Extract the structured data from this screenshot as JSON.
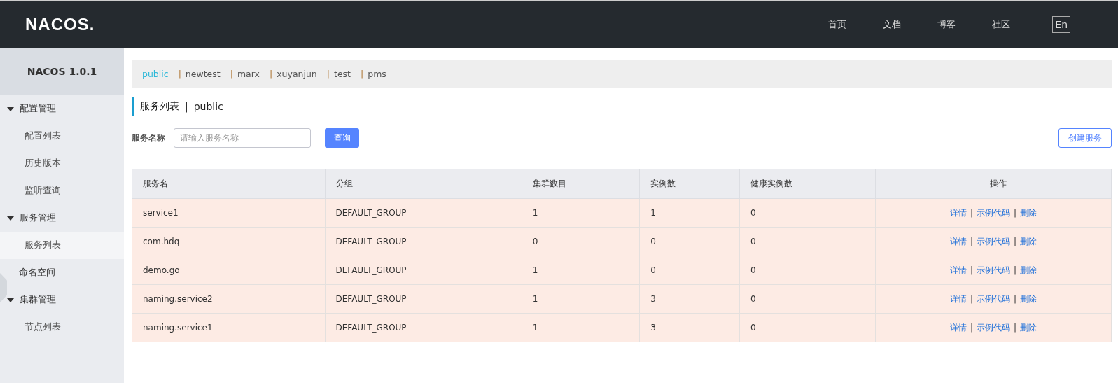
{
  "header": {
    "logo": "NACOS.",
    "nav": [
      "首页",
      "文档",
      "博客",
      "社区"
    ],
    "language_button": "En"
  },
  "sidebar": {
    "title": "NACOS 1.0.1",
    "items": [
      {
        "kind": "group",
        "label": "配置管理",
        "expanded": true,
        "children": [
          {
            "label": "配置列表",
            "selected": false
          },
          {
            "label": "历史版本",
            "selected": false
          },
          {
            "label": "监听查询",
            "selected": false
          }
        ]
      },
      {
        "kind": "group",
        "label": "服务管理",
        "expanded": true,
        "children": [
          {
            "label": "服务列表",
            "selected": true
          }
        ]
      },
      {
        "kind": "link",
        "label": "命名空间",
        "selected": false
      },
      {
        "kind": "group",
        "label": "集群管理",
        "expanded": true,
        "children": [
          {
            "label": "节点列表",
            "selected": false
          }
        ]
      }
    ]
  },
  "namespaces": [
    {
      "kind": "tab",
      "text": "public",
      "selected": true
    },
    {
      "kind": "sep",
      "text": "|"
    },
    {
      "kind": "tab",
      "text": "newtest",
      "selected": false
    },
    {
      "kind": "sep",
      "text": "|"
    },
    {
      "kind": "tab",
      "text": "marx",
      "selected": false
    },
    {
      "kind": "sep",
      "text": "|"
    },
    {
      "kind": "tab",
      "text": "xuyanjun",
      "selected": false
    },
    {
      "kind": "sep",
      "text": "|"
    },
    {
      "kind": "tab",
      "text": "test",
      "selected": false
    },
    {
      "kind": "sep",
      "text": "|"
    },
    {
      "kind": "tab",
      "text": "pms",
      "selected": false
    }
  ],
  "page_title": {
    "title": "服务列表",
    "separator": "|",
    "namespace": "public"
  },
  "search": {
    "label": "服务名称",
    "placeholder": "请输入服务名称",
    "button": "查询",
    "create_button": "创建服务"
  },
  "table": {
    "columns": [
      "服务名",
      "分组",
      "集群数目",
      "实例数",
      "健康实例数",
      "操作"
    ],
    "rows": [
      {
        "cells": [
          "service1",
          "DEFAULT_GROUP",
          "1",
          "1",
          "0"
        ],
        "actions": [
          {
            "kind": "link",
            "text": "详情"
          },
          {
            "kind": "sep",
            "text": "|"
          },
          {
            "kind": "link",
            "text": "示例代码"
          },
          {
            "kind": "sep",
            "text": "|"
          },
          {
            "kind": "link",
            "text": "删除"
          }
        ]
      },
      {
        "cells": [
          "com.hdq",
          "DEFAULT_GROUP",
          "0",
          "0",
          "0"
        ],
        "actions": [
          {
            "kind": "link",
            "text": "详情"
          },
          {
            "kind": "sep",
            "text": "|"
          },
          {
            "kind": "link",
            "text": "示例代码"
          },
          {
            "kind": "sep",
            "text": "|"
          },
          {
            "kind": "link",
            "text": "删除"
          }
        ]
      },
      {
        "cells": [
          "demo.go",
          "DEFAULT_GROUP",
          "1",
          "0",
          "0"
        ],
        "actions": [
          {
            "kind": "link",
            "text": "详情"
          },
          {
            "kind": "sep",
            "text": "|"
          },
          {
            "kind": "link",
            "text": "示例代码"
          },
          {
            "kind": "sep",
            "text": "|"
          },
          {
            "kind": "link",
            "text": "删除"
          }
        ]
      },
      {
        "cells": [
          "naming.service2",
          "DEFAULT_GROUP",
          "1",
          "3",
          "0"
        ],
        "actions": [
          {
            "kind": "link",
            "text": "详情"
          },
          {
            "kind": "sep",
            "text": "|"
          },
          {
            "kind": "link",
            "text": "示例代码"
          },
          {
            "kind": "sep",
            "text": "|"
          },
          {
            "kind": "link",
            "text": "删除"
          }
        ]
      },
      {
        "cells": [
          "naming.service1",
          "DEFAULT_GROUP",
          "1",
          "3",
          "0"
        ],
        "actions": [
          {
            "kind": "link",
            "text": "详情"
          },
          {
            "kind": "sep",
            "text": "|"
          },
          {
            "kind": "link",
            "text": "示例代码"
          },
          {
            "kind": "sep",
            "text": "|"
          },
          {
            "kind": "link",
            "text": "删除"
          }
        ]
      }
    ]
  }
}
